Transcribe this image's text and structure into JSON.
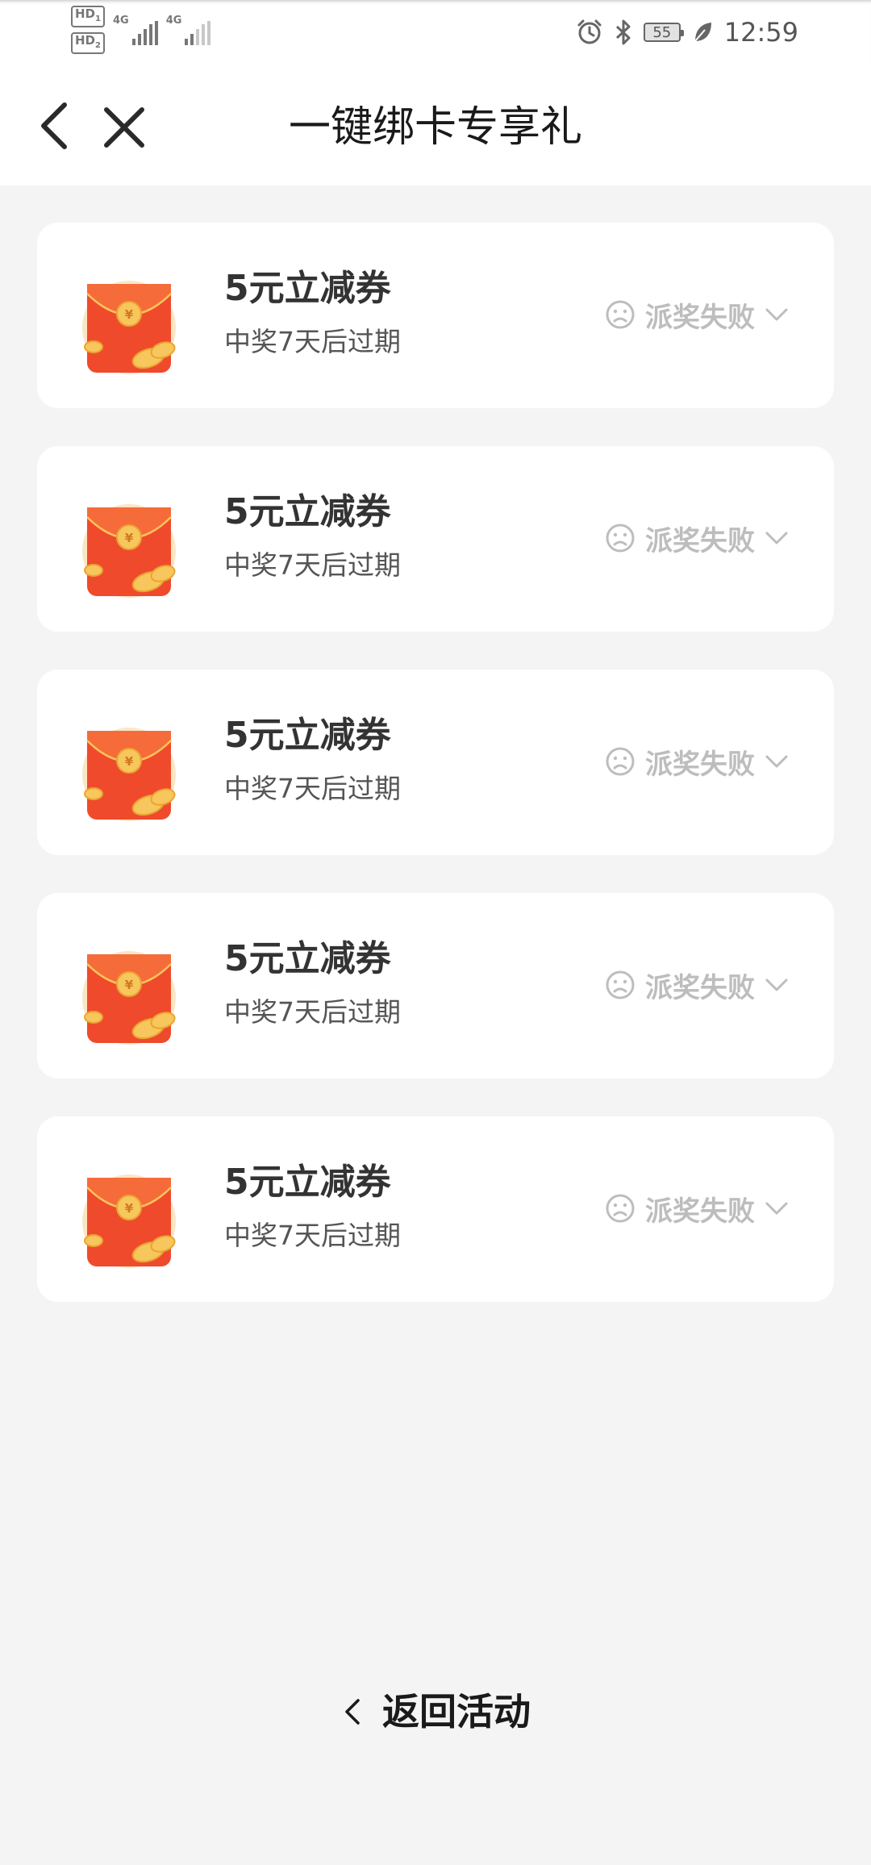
{
  "status_bar": {
    "sim1_label": "HD",
    "sim1_index": "1",
    "sim2_label": "HD",
    "sim2_index": "2",
    "network1": "4G",
    "network2": "4G",
    "battery_level": "55",
    "time": "12:59"
  },
  "header": {
    "title": "一键绑卡专享礼"
  },
  "rewards": [
    {
      "title": "5元立减券",
      "subtitle": "中奖7天后过期",
      "status": "派奖失败"
    },
    {
      "title": "5元立减券",
      "subtitle": "中奖7天后过期",
      "status": "派奖失败"
    },
    {
      "title": "5元立减券",
      "subtitle": "中奖7天后过期",
      "status": "派奖失败"
    },
    {
      "title": "5元立减券",
      "subtitle": "中奖7天后过期",
      "status": "派奖失败"
    },
    {
      "title": "5元立减券",
      "subtitle": "中奖7天后过期",
      "status": "派奖失败"
    }
  ],
  "footer": {
    "return_label": "返回活动"
  },
  "icons": {
    "back": "chevron-left-icon",
    "close": "close-icon",
    "envelope": "red-envelope-icon",
    "sad": "sad-face-icon",
    "expand": "chevron-down-icon",
    "alarm": "alarm-icon",
    "bluetooth": "bluetooth-icon",
    "leaf": "leaf-icon"
  },
  "colors": {
    "envelope_red": "#f04a2c",
    "envelope_gold": "#f7c65c",
    "status_gray": "#bdbdbd",
    "background": "#f4f4f4"
  }
}
